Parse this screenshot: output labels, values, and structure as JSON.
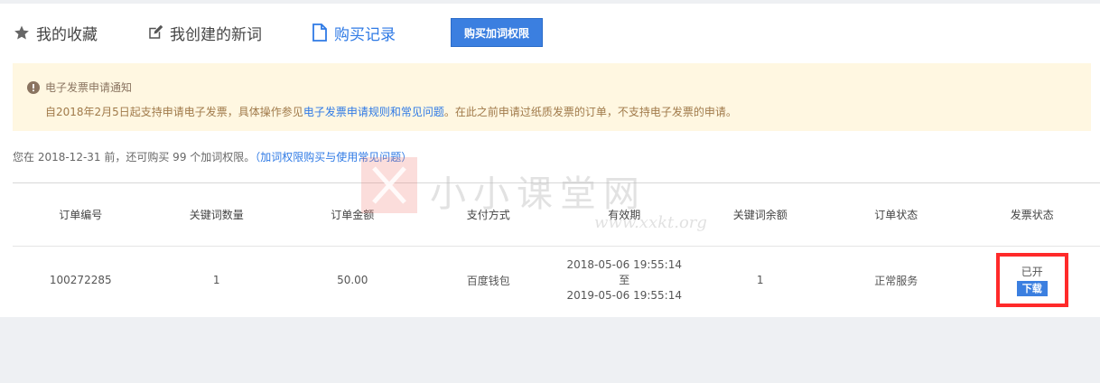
{
  "tabs": {
    "favorites": "我的收藏",
    "created_words": "我创建的新词",
    "purchase_records": "购买记录",
    "buy_button": "购买加词权限"
  },
  "notice": {
    "title": "电子发票申请通知",
    "body_prefix": "自2018年2月5日起支持申请电子发票，具体操作参见",
    "body_link": "电子发票申请规则和常见问题",
    "body_suffix": "。在此之前申请过纸质发票的订单，不支持电子发票的申请。"
  },
  "remain": {
    "text": "您在 2018-12-31 前，还可购买 99 个加词权限。",
    "link": "（加词权限购买与使用常见问题）"
  },
  "table": {
    "headers": [
      "订单编号",
      "关键词数量",
      "订单金额",
      "支付方式",
      "有效期",
      "关键词余额",
      "订单状态",
      "发票状态"
    ],
    "rows": [
      {
        "order_id": "100272285",
        "keyword_count": "1",
        "amount": "50.00",
        "payment": "百度钱包",
        "validity_start": "2018-05-06 19:55:14",
        "validity_to": "至",
        "validity_end": "2019-05-06 19:55:14",
        "keyword_balance": "1",
        "order_status": "正常服务",
        "invoice_status": "已开",
        "download": "下载"
      }
    ]
  },
  "watermark": {
    "text": "小小课堂网",
    "url": "www.xxkt.org"
  },
  "colors": {
    "accent": "#3b7fe0",
    "link": "#2f7ae5",
    "notice_bg": "#fff7e1",
    "highlight": "#ff2a2a"
  }
}
